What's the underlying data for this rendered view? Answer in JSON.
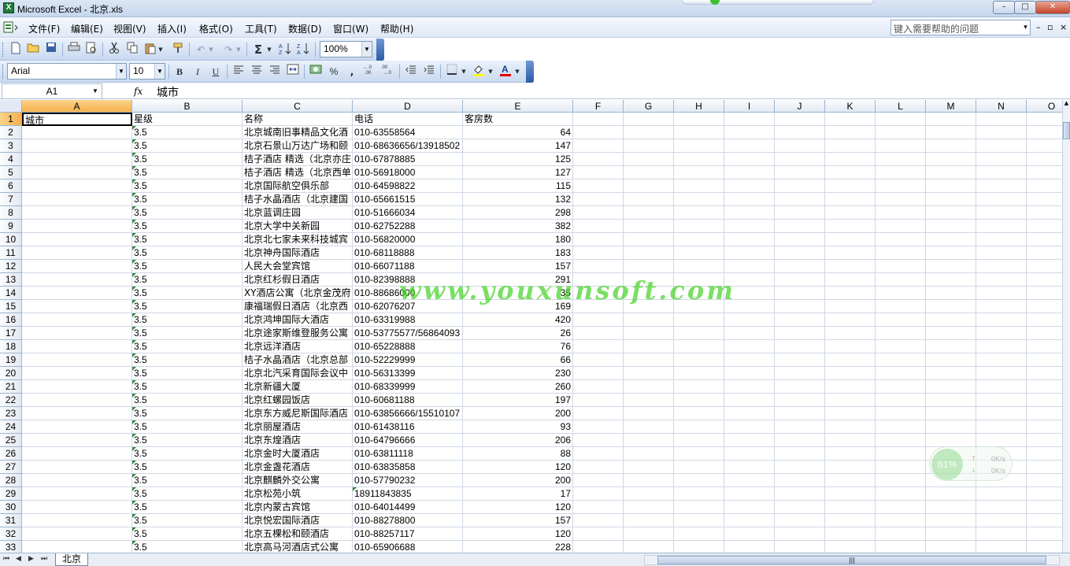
{
  "window": {
    "title": "Microsoft Excel - 北京.xls",
    "app_icon_glyph": "X",
    "controls": {
      "minimize": "–",
      "maximize": "□",
      "close": "✕"
    }
  },
  "menu": {
    "items": [
      "文件(F)",
      "编辑(E)",
      "视图(V)",
      "插入(I)",
      "格式(O)",
      "工具(T)",
      "数据(D)",
      "窗口(W)",
      "帮助(H)"
    ],
    "help_placeholder": "键入需要帮助的问题",
    "mdi_controls": [
      "▾",
      "–",
      "▫",
      "×"
    ]
  },
  "toolbar_standard": {
    "zoom": "100%"
  },
  "toolbar_format": {
    "font": "Arial",
    "size": "10",
    "percent": "%",
    "comma": ","
  },
  "formula_bar": {
    "name_box": "A1",
    "fx": "fx",
    "content": "城市"
  },
  "columns": [
    "A",
    "B",
    "C",
    "D",
    "E",
    "F",
    "G",
    "H",
    "I",
    "J",
    "K",
    "L",
    "M",
    "N",
    "O"
  ],
  "header_row": [
    "城市",
    "星级",
    "名称",
    "电话",
    "客房数"
  ],
  "rows": [
    [
      "",
      "3.5",
      "北京城南旧事精品文化酒",
      "010-63558564",
      "64"
    ],
    [
      "",
      "3.5",
      "北京石景山万达广场和颐",
      "010-68636656/13918502",
      "147"
    ],
    [
      "",
      "3.5",
      "桔子酒店 精选（北京亦庄",
      "010-67878885",
      "125"
    ],
    [
      "",
      "3.5",
      "桔子酒店 精选（北京西单",
      "010-56918000",
      "127"
    ],
    [
      "",
      "3.5",
      "北京国际航空俱乐部",
      "010-64598822",
      "115"
    ],
    [
      "",
      "3.5",
      "桔子水晶酒店（北京建国",
      "010-65661515",
      "132"
    ],
    [
      "",
      "3.5",
      "北京蓝调庄园",
      "010-51666034",
      "298"
    ],
    [
      "",
      "3.5",
      "北京大学中关新园",
      "010-62752288",
      "382"
    ],
    [
      "",
      "3.5",
      "北京北七家未来科技城宾",
      "010-56820000",
      "180"
    ],
    [
      "",
      "3.5",
      "北京神舟国际酒店",
      "010-68118888",
      "183"
    ],
    [
      "",
      "3.5",
      "人民大会堂宾馆",
      "010-66071188",
      "157"
    ],
    [
      "",
      "3.5",
      "北京红杉假日酒店",
      "010-82398888",
      "291"
    ],
    [
      "",
      "3.5",
      "XY酒店公寓（北京金茂府",
      "010-88686000",
      "35"
    ],
    [
      "",
      "3.5",
      "康福瑞假日酒店（北京西",
      "010-62076207",
      "169"
    ],
    [
      "",
      "3.5",
      "北京鸿坤国际大酒店",
      "010-63319988",
      "420"
    ],
    [
      "",
      "3.5",
      "北京途家斯维登服务公寓",
      "010-53775577/56864093",
      "26"
    ],
    [
      "",
      "3.5",
      "北京远洋酒店",
      "010-65228888",
      "76"
    ],
    [
      "",
      "3.5",
      "桔子水晶酒店（北京总部",
      "010-52229999",
      "66"
    ],
    [
      "",
      "3.5",
      "北京北汽采育国际会议中",
      "010-56313399",
      "230"
    ],
    [
      "",
      "3.5",
      "北京新疆大厦",
      "010-68339999",
      "260"
    ],
    [
      "",
      "3.5",
      "北京红螺园饭店",
      "010-60681188",
      "197"
    ],
    [
      "",
      "3.5",
      "北京东方威尼斯国际酒店",
      "010-63856666/15510107",
      "200"
    ],
    [
      "",
      "3.5",
      "北京丽屋酒店",
      "010-61438116",
      "93"
    ],
    [
      "",
      "3.5",
      "北京东煌酒店",
      "010-64796666",
      "206"
    ],
    [
      "",
      "3.5",
      "北京金时大厦酒店",
      "010-63811118",
      "88"
    ],
    [
      "",
      "3.5",
      "北京金盏花酒店",
      "010-63835858",
      "120"
    ],
    [
      "",
      "3.5",
      "北京麒麟外交公寓",
      "010-57790232",
      "200"
    ],
    [
      "",
      "3.5",
      "北京松苑小筑",
      "18911843835",
      "17"
    ],
    [
      "",
      "3.5",
      "北京内蒙古宾馆",
      "010-64014499",
      "120"
    ],
    [
      "",
      "3.5",
      "北京悦宏国际酒店",
      "010-88278800",
      "157"
    ],
    [
      "",
      "3.5",
      "北京五棵松和颐酒店",
      "010-88257117",
      "120"
    ],
    [
      "",
      "3.5",
      "北京高马河酒店式公寓",
      "010-65906688",
      "228"
    ]
  ],
  "sheet_tab": "北京",
  "sheet_nav": [
    "⏮",
    "◀",
    "▶",
    "⏭"
  ],
  "watermark": "www.youxunsoft.com",
  "speed_widget": {
    "percent": "61%",
    "up": "0K/s",
    "down": "0K/s"
  }
}
